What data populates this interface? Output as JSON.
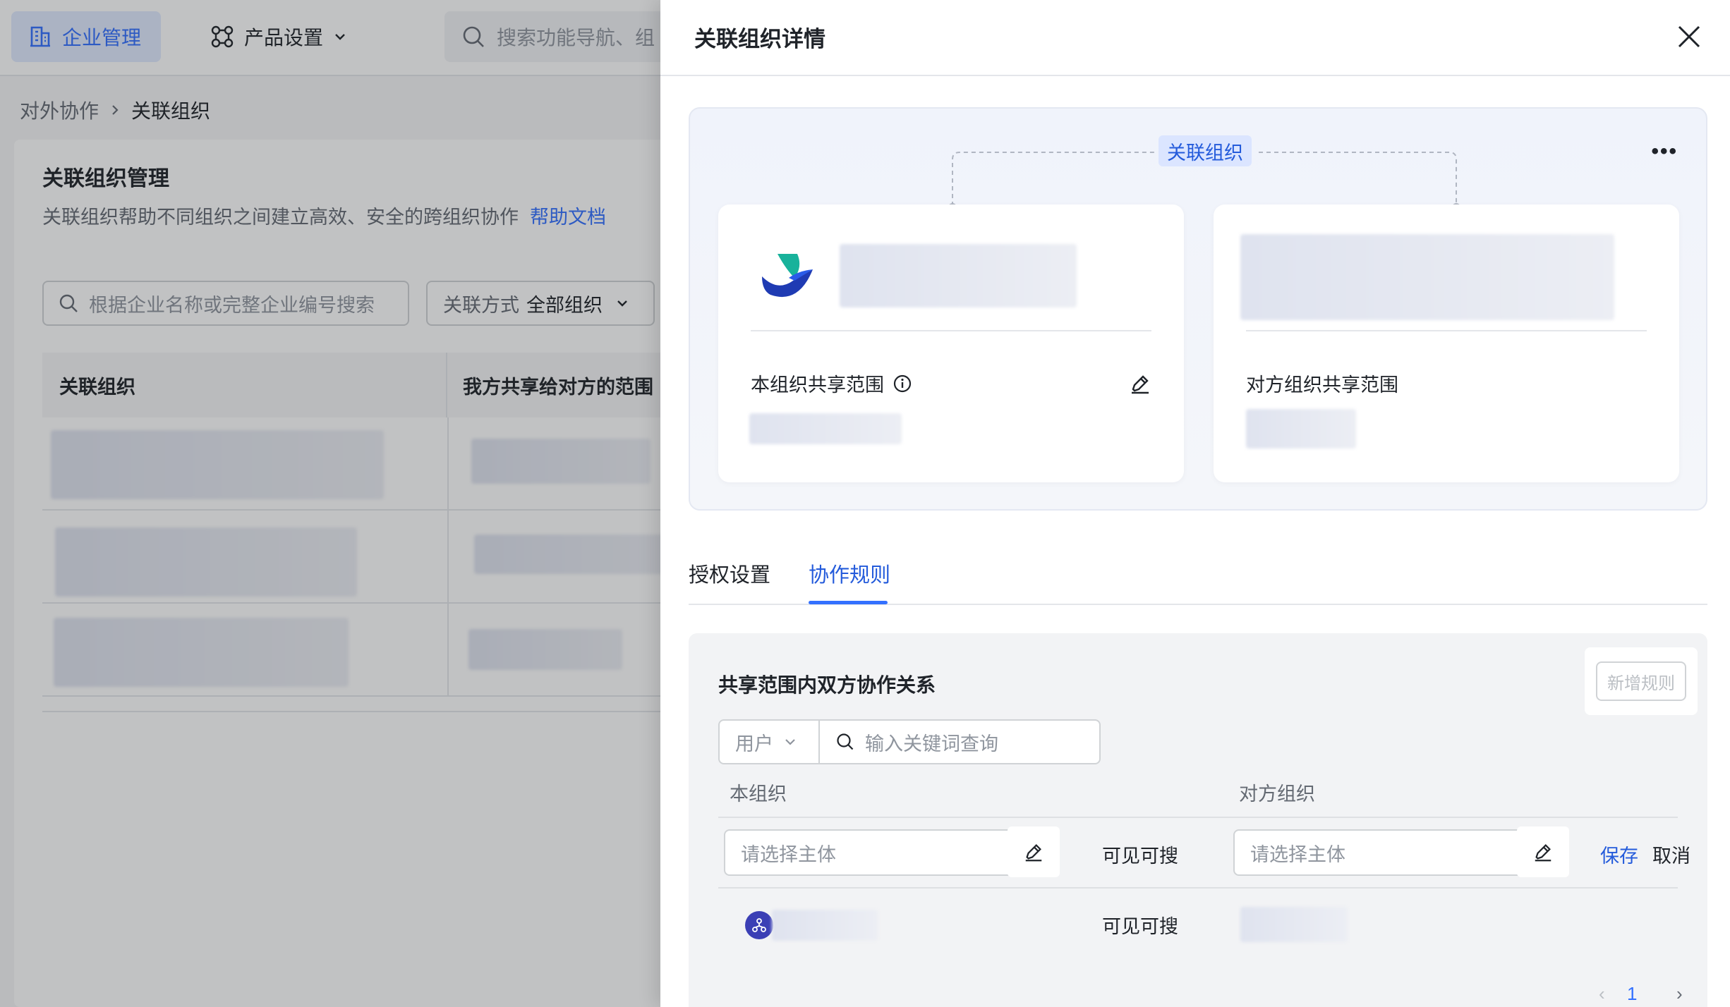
{
  "topbar": {
    "tab_active": "企业管理",
    "tab_product": "产品设置",
    "search_placeholder": "搜索功能导航、组"
  },
  "breadcrumb": {
    "parent": "对外协作",
    "current": "关联组织"
  },
  "main": {
    "title": "关联组织管理",
    "description": "关联组织帮助不同组织之间建立高效、安全的跨组织协作",
    "help_link": "帮助文档",
    "search_placeholder": "根据企业名称或完整企业编号搜索",
    "filter_label": "关联方式",
    "filter_value": "全部组织",
    "table_headers": [
      "关联组织",
      "我方共享给对方的范围"
    ]
  },
  "drawer": {
    "title": "关联组织详情",
    "badge": "关联组织",
    "own_org_label": "本组织共享范围",
    "peer_org_label": "对方组织共享范围",
    "tabs": [
      "授权设置",
      "协作规则"
    ],
    "active_tab": "协作规则",
    "rules": {
      "title": "共享范围内双方协作关系",
      "add_rule": "新增规则",
      "type_select": "用户",
      "search_placeholder": "输入关键词查询",
      "col_own": "本组织",
      "col_peer": "对方组织",
      "pick_placeholder": "请选择主体",
      "relation": "可见可搜",
      "save": "保存",
      "cancel": "取消",
      "page": "1"
    }
  },
  "colors": {
    "accent": "#3370ff",
    "accent_dark": "#245bdb",
    "badge_bg": "#dbe5ff"
  }
}
